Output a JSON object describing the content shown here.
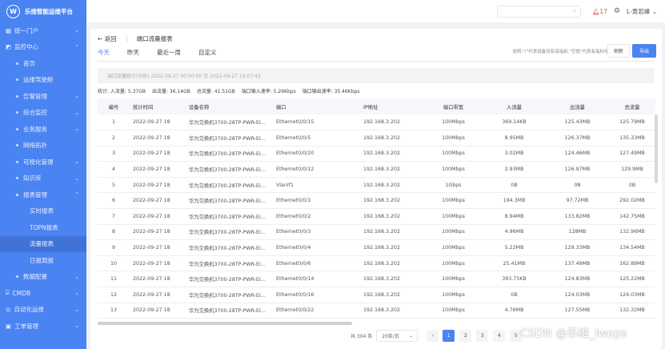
{
  "app": {
    "title": "乐维智能运维平台"
  },
  "sidebar": {
    "items": [
      {
        "label": "统一门户",
        "level": 1,
        "chevron": "⌄"
      },
      {
        "label": "监控中心",
        "level": 1,
        "chevron": "⌃"
      },
      {
        "label": "首页",
        "level": 2
      },
      {
        "label": "运维驾驶舱",
        "level": 2
      },
      {
        "label": "告警管理",
        "level": 2,
        "chevron": "⌄"
      },
      {
        "label": "综合监控",
        "level": 2,
        "chevron": "⌄"
      },
      {
        "label": "业务服务",
        "level": 2,
        "chevron": "⌄"
      },
      {
        "label": "网络拓扑",
        "level": 2
      },
      {
        "label": "可视化管理",
        "level": 2,
        "chevron": "⌄"
      },
      {
        "label": "知识库",
        "level": 2,
        "chevron": "⌄"
      },
      {
        "label": "报表管理",
        "level": 2,
        "chevron": "⌃"
      },
      {
        "label": "实时报表",
        "level": 3
      },
      {
        "label": "TOPN报表",
        "level": 3
      },
      {
        "label": "流量报表",
        "level": 3,
        "active": true
      },
      {
        "label": "日报周报",
        "level": 3
      },
      {
        "label": "数据配置",
        "level": 2,
        "chevron": "⌄"
      },
      {
        "label": "CMDB",
        "level": 1,
        "chevron": "⌄"
      },
      {
        "label": "自动化运维",
        "level": 1,
        "chevron": "⌄"
      },
      {
        "label": "工单管理",
        "level": 1,
        "chevron": "⌄"
      }
    ]
  },
  "topbar": {
    "alerts": "17",
    "user": "L-黄若峰"
  },
  "page": {
    "back": "返回",
    "title": "端口流量报表",
    "tabs": [
      "今天",
      "昨天",
      "最近一周",
      "自定义"
    ],
    "note": "说明:\"/\"代表设备没有该指标,\"空值\"代表有指标但没数据",
    "refresh": "刷新",
    "export": "导出",
    "range": "端口流量统计(分析) 2022-09-27 00:00:00 至 2022-09-27 19:07:43",
    "stats": [
      "统计: 入流量: 5.37GB",
      "出流量: 36.14GB",
      "总流量: 41.51GB",
      "端口输入速率: 5.26Kbps",
      "端口输出速率: 35.46Kbps"
    ]
  },
  "table": {
    "columns": [
      "编号",
      "统计时间",
      "设备名称",
      "端口",
      "IP地址",
      "端口带宽",
      "入流量",
      "出流量",
      "总流量"
    ],
    "rows": [
      [
        "1",
        "2022-09-27 18",
        "华为交换机3700-28TP-PWR-EI...",
        "Ethernet0/0/15",
        "192.168.3.202",
        "100Mbps",
        "369.14KB",
        "125.43MB",
        "125.79MB"
      ],
      [
        "2",
        "2022-09-27 18",
        "华为交换机3700-28TP-PWR-EI...",
        "Ethernet0/0/5",
        "192.168.3.202",
        "100Mbps",
        "8.95MB",
        "126.37MB",
        "135.33MB"
      ],
      [
        "3",
        "2022-09-27 18",
        "华为交换机3700-28TP-PWR-EI...",
        "Ethernet0/0/20",
        "192.168.3.202",
        "100Mbps",
        "3.02MB",
        "124.46MB",
        "127.49MB"
      ],
      [
        "4",
        "2022-09-27 18",
        "华为交换机3700-28TP-PWR-EI...",
        "Ethernet0/0/12",
        "192.168.3.202",
        "100Mbps",
        "2.93MB",
        "126.97MB",
        "129.9MB"
      ],
      [
        "5",
        "2022-09-27 18",
        "华为交换机3700-28TP-PWR-EI...",
        "Vlanif1",
        "192.168.3.202",
        "1Gbps",
        "0B",
        "0B",
        "0B"
      ],
      [
        "6",
        "2022-09-27 18",
        "华为交换机3700-28TP-PWR-EI...",
        "Ethernet0/0/1",
        "192.168.3.202",
        "100Mbps",
        "194.3MB",
        "97.72MB",
        "292.02MB"
      ],
      [
        "7",
        "2022-09-27 18",
        "华为交换机3700-28TP-PWR-EI...",
        "Ethernet0/0/2",
        "192.168.3.202",
        "100Mbps",
        "8.94MB",
        "133.82MB",
        "142.75MB"
      ],
      [
        "8",
        "2022-09-27 18",
        "华为交换机3700-28TP-PWR-EI...",
        "Ethernet0/0/3",
        "192.168.3.202",
        "100Mbps",
        "4.96MB",
        "128MB",
        "132.96MB"
      ],
      [
        "9",
        "2022-09-27 18",
        "华为交换机3700-28TP-PWR-EI...",
        "Ethernet0/0/4",
        "192.168.3.202",
        "100Mbps",
        "5.22MB",
        "129.33MB",
        "134.54MB"
      ],
      [
        "10",
        "2022-09-27 18",
        "华为交换机3700-28TP-PWR-EI...",
        "Ethernet0/0/6",
        "192.168.3.202",
        "100Mbps",
        "25.41MB",
        "137.49MB",
        "162.89MB"
      ],
      [
        "11",
        "2022-09-27 18",
        "华为交换机3700-28TP-PWR-EI...",
        "Ethernet0/0/14",
        "192.168.3.202",
        "100Mbps",
        "393.75KB",
        "124.83MB",
        "125.22MB"
      ],
      [
        "12",
        "2022-09-27 18",
        "华为交换机3700-28TP-PWR-EI...",
        "Ethernet0/0/16",
        "192.168.3.202",
        "100Mbps",
        "0B",
        "124.03MB",
        "124.03MB"
      ],
      [
        "13",
        "2022-09-27 18",
        "华为交换机3700-28TP-PWR-EI...",
        "Ethernet0/0/22",
        "192.168.3.202",
        "100Mbps",
        "4.76MB",
        "127.55MB",
        "132.32MB"
      ]
    ]
  },
  "pagination": {
    "total": "共 304 条",
    "page_size": "20条/页",
    "pages": [
      "1",
      "2",
      "3",
      "4",
      "5"
    ],
    "current": "1"
  },
  "watermark": "CSDN @乐维_lwops"
}
